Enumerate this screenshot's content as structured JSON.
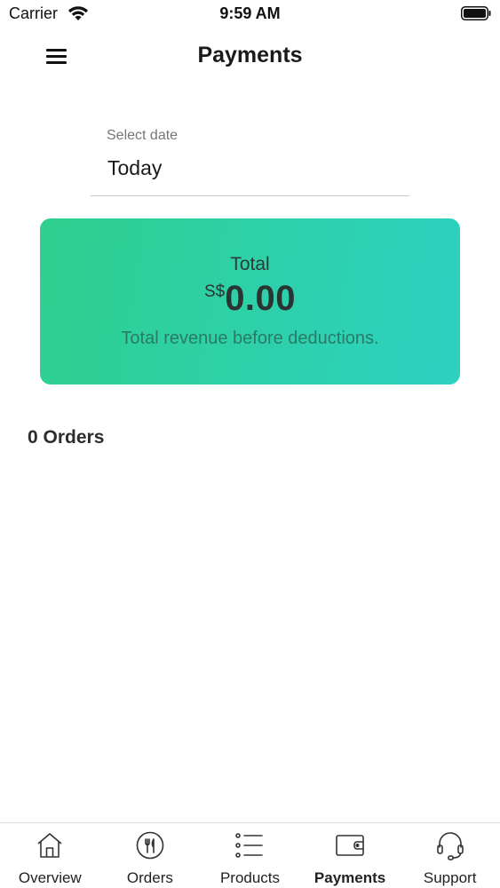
{
  "status_bar": {
    "carrier": "Carrier",
    "time": "9:59 AM"
  },
  "header": {
    "title": "Payments",
    "menu_icon": "hamburger-menu-icon"
  },
  "date_select": {
    "label": "Select date",
    "value": "Today"
  },
  "total_card": {
    "label": "Total",
    "currency": "S$",
    "amount": "0.00",
    "note": "Total revenue before deductions.",
    "gradient_start": "#2fd08e",
    "gradient_end": "#2cd1c2"
  },
  "orders": {
    "count_label": "0 Orders"
  },
  "tab_bar": {
    "active": "Payments",
    "items": [
      {
        "label": "Overview",
        "icon": "home-icon"
      },
      {
        "label": "Orders",
        "icon": "utensils-icon"
      },
      {
        "label": "Products",
        "icon": "list-icon"
      },
      {
        "label": "Payments",
        "icon": "wallet-icon"
      },
      {
        "label": "Support",
        "icon": "headset-icon"
      }
    ]
  }
}
